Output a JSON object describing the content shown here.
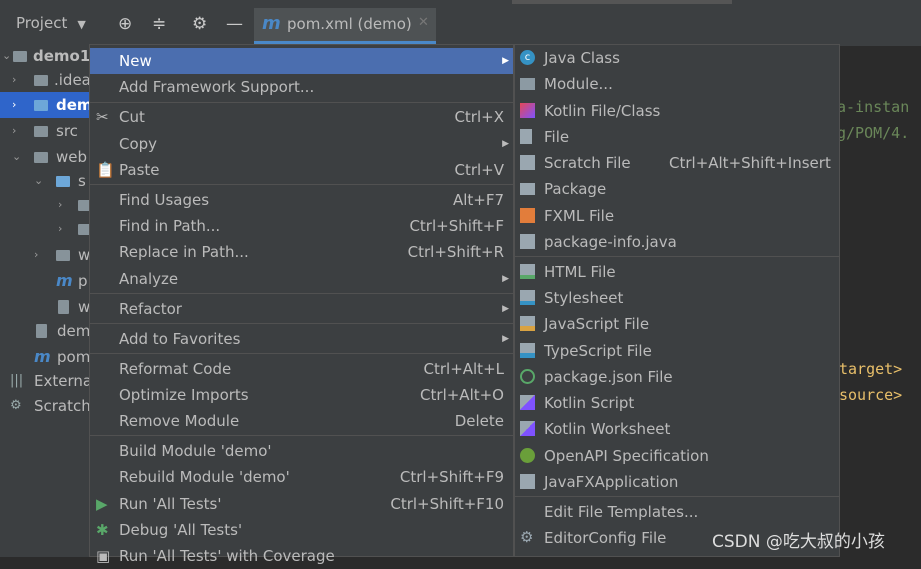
{
  "toolbar": {
    "project_label": "Project",
    "tab_label": "pom.xml (demo)"
  },
  "tree": {
    "rows": [
      {
        "label": "demo1"
      },
      {
        "label": ".idea"
      },
      {
        "label": "demo"
      },
      {
        "label": "src"
      },
      {
        "label": "web"
      },
      {
        "label": "s"
      },
      {
        "label": ""
      },
      {
        "label": ""
      },
      {
        "label": "w"
      },
      {
        "label": "p"
      },
      {
        "label": "w"
      },
      {
        "label": "dem"
      },
      {
        "label": "pom"
      },
      {
        "label": "Externa"
      },
      {
        "label": "Scratch"
      }
    ]
  },
  "editor": {
    "lines": [
      "a-instan",
      "g/POM/4.",
      "target>",
      "source>"
    ]
  },
  "context_menu": {
    "items": [
      {
        "label": "New",
        "shortcut": "",
        "submenu": true,
        "icon": ""
      },
      {
        "label": "Add Framework Support...",
        "shortcut": "",
        "submenu": false,
        "icon": ""
      },
      {
        "label": "Cut",
        "shortcut": "Ctrl+X",
        "submenu": false,
        "icon": "scissors-icon"
      },
      {
        "label": "Copy",
        "shortcut": "",
        "submenu": true,
        "icon": ""
      },
      {
        "label": "Paste",
        "shortcut": "Ctrl+V",
        "submenu": false,
        "icon": "clipboard-icon"
      },
      {
        "label": "Find Usages",
        "shortcut": "Alt+F7",
        "submenu": false,
        "icon": ""
      },
      {
        "label": "Find in Path...",
        "shortcut": "Ctrl+Shift+F",
        "submenu": false,
        "icon": ""
      },
      {
        "label": "Replace in Path...",
        "shortcut": "Ctrl+Shift+R",
        "submenu": false,
        "icon": ""
      },
      {
        "label": "Analyze",
        "shortcut": "",
        "submenu": true,
        "icon": ""
      },
      {
        "label": "Refactor",
        "shortcut": "",
        "submenu": true,
        "icon": ""
      },
      {
        "label": "Add to Favorites",
        "shortcut": "",
        "submenu": true,
        "icon": ""
      },
      {
        "label": "Reformat Code",
        "shortcut": "Ctrl+Alt+L",
        "submenu": false,
        "icon": ""
      },
      {
        "label": "Optimize Imports",
        "shortcut": "Ctrl+Alt+O",
        "submenu": false,
        "icon": ""
      },
      {
        "label": "Remove Module",
        "shortcut": "Delete",
        "submenu": false,
        "icon": ""
      },
      {
        "label": "Build Module 'demo'",
        "shortcut": "",
        "submenu": false,
        "icon": ""
      },
      {
        "label": "Rebuild Module 'demo'",
        "shortcut": "Ctrl+Shift+F9",
        "submenu": false,
        "icon": ""
      },
      {
        "label": "Run 'All Tests'",
        "shortcut": "Ctrl+Shift+F10",
        "submenu": false,
        "icon": "run-icon"
      },
      {
        "label": "Debug 'All Tests'",
        "shortcut": "",
        "submenu": false,
        "icon": "debug-icon"
      },
      {
        "label": "Run 'All Tests' with Coverage",
        "shortcut": "",
        "submenu": false,
        "icon": "coverage-icon"
      }
    ]
  },
  "new_submenu": {
    "items": [
      {
        "label": "Java Class",
        "shortcut": "",
        "icon": "java-class-icon"
      },
      {
        "label": "Module...",
        "shortcut": "",
        "icon": "module-icon"
      },
      {
        "label": "Kotlin File/Class",
        "shortcut": "",
        "icon": "kotlin-icon"
      },
      {
        "label": "File",
        "shortcut": "",
        "icon": "file-icon"
      },
      {
        "label": "Scratch File",
        "shortcut": "Ctrl+Alt+Shift+Insert",
        "icon": "scratch-file-icon"
      },
      {
        "label": "Package",
        "shortcut": "",
        "icon": "package-icon"
      },
      {
        "label": "FXML File",
        "shortcut": "",
        "icon": "fxml-icon"
      },
      {
        "label": "package-info.java",
        "shortcut": "",
        "icon": "java-file-icon"
      },
      {
        "label": "HTML File",
        "shortcut": "",
        "icon": "html-icon"
      },
      {
        "label": "Stylesheet",
        "shortcut": "",
        "icon": "css-icon"
      },
      {
        "label": "JavaScript File",
        "shortcut": "",
        "icon": "js-icon"
      },
      {
        "label": "TypeScript File",
        "shortcut": "",
        "icon": "ts-icon"
      },
      {
        "label": "package.json File",
        "shortcut": "",
        "icon": "nodejs-icon"
      },
      {
        "label": "Kotlin Script",
        "shortcut": "",
        "icon": "kotlin-script-icon"
      },
      {
        "label": "Kotlin Worksheet",
        "shortcut": "",
        "icon": "kotlin-worksheet-icon"
      },
      {
        "label": "OpenAPI Specification",
        "shortcut": "",
        "icon": "openapi-icon"
      },
      {
        "label": "JavaFXApplication",
        "shortcut": "",
        "icon": "javafx-icon"
      },
      {
        "label": "Edit File Templates...",
        "shortcut": "",
        "icon": ""
      },
      {
        "label": "EditorConfig File",
        "shortcut": "",
        "icon": "gear-icon"
      }
    ]
  },
  "watermark": "CSDN @吃大叔的小孩",
  "colors": {
    "highlight": "#4b6eaf",
    "selection": "#2f65ca",
    "background": "#3c3f41"
  }
}
